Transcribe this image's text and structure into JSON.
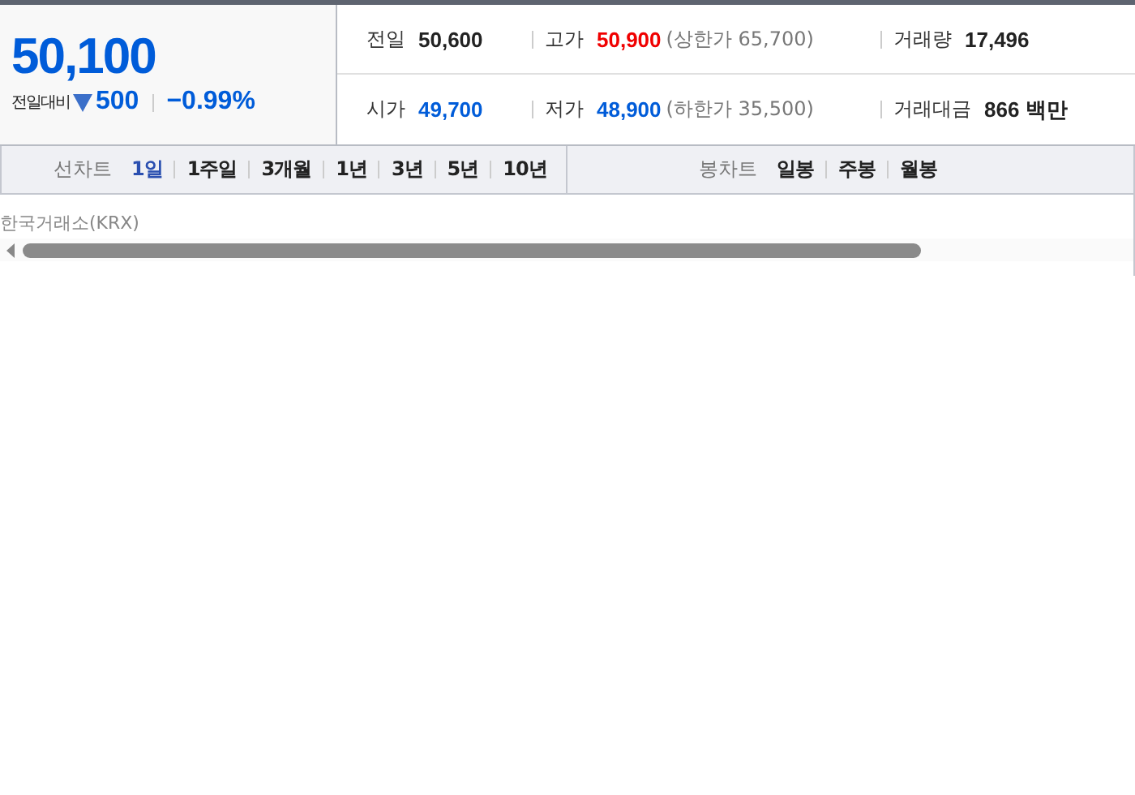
{
  "quote": {
    "price": "50,100",
    "change_label": "전일대비",
    "falling": true,
    "change": "500",
    "rate": "−0.99%"
  },
  "stats": [
    {
      "label": "전일",
      "value": "50,600",
      "color": "#222222"
    },
    {
      "label": "고가",
      "value": "50,900",
      "color": "#f00000",
      "limit": "(상한가 65,700)"
    },
    {
      "label": "거래량",
      "value": "17,496",
      "color": "#222222"
    },
    {
      "label": "시가",
      "value": "49,700",
      "color": "#005cd9"
    },
    {
      "label": "저가",
      "value": "48,900",
      "color": "#005cd9",
      "limit": "(하한가 35,500)"
    },
    {
      "label": "거래대금",
      "value": "866 백만",
      "color": "#222222"
    }
  ],
  "line_chart": {
    "label": "선차트",
    "periods": [
      {
        "label": "1일",
        "selected": true
      },
      {
        "label": "1주일",
        "selected": false
      },
      {
        "label": "3개월",
        "selected": false
      },
      {
        "label": "1년",
        "selected": false
      },
      {
        "label": "3년",
        "selected": false
      },
      {
        "label": "5년",
        "selected": false
      },
      {
        "label": "10년",
        "selected": false
      }
    ]
  },
  "candle_chart": {
    "label": "봉차트",
    "periods": [
      {
        "label": "일봉",
        "selected": false
      },
      {
        "label": "주봉",
        "selected": false
      },
      {
        "label": "월봉",
        "selected": false
      }
    ]
  },
  "exchange": "한국거래소(KRX)"
}
